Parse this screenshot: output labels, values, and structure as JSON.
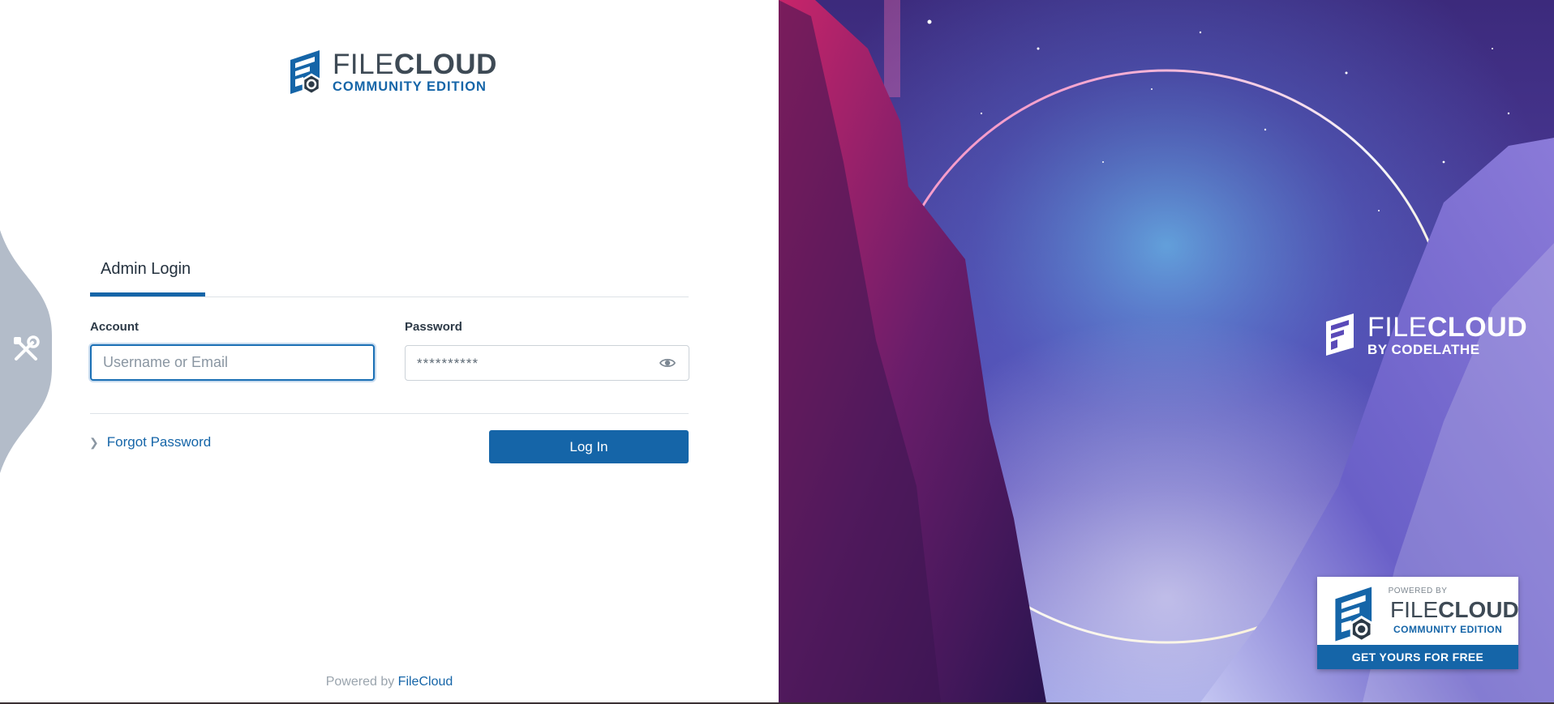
{
  "brand": {
    "logo_main_light": "FILE",
    "logo_main_bold": "CLOUD",
    "logo_sub": "COMMUNITY EDITION"
  },
  "login": {
    "tab_label": "Admin Login",
    "account_label": "Account",
    "account_placeholder": "Username or Email",
    "account_value": "",
    "password_label": "Password",
    "password_placeholder": "**********",
    "password_value": "",
    "forgot_label": "Forgot Password",
    "login_button": "Log In"
  },
  "footer": {
    "powered_prefix": "Powered by",
    "powered_link": "FileCloud"
  },
  "hero": {
    "brand_main_light": "FILE",
    "brand_main_bold": "CLOUD",
    "brand_sub": "BY CODELATHE"
  },
  "promo": {
    "powered_by": "POWERED BY",
    "main_light": "FILE",
    "main_bold": "CLOUD",
    "sub": "COMMUNITY EDITION",
    "cta": "GET YOURS FOR FREE"
  },
  "icons": {
    "side_tool": "tools-icon",
    "password_toggle": "eye-icon",
    "forgot_chevron": "chevron-right-icon"
  },
  "colors": {
    "accent": "#1565a8",
    "side_tab": "#b3bcc9",
    "text": "#23303c"
  }
}
